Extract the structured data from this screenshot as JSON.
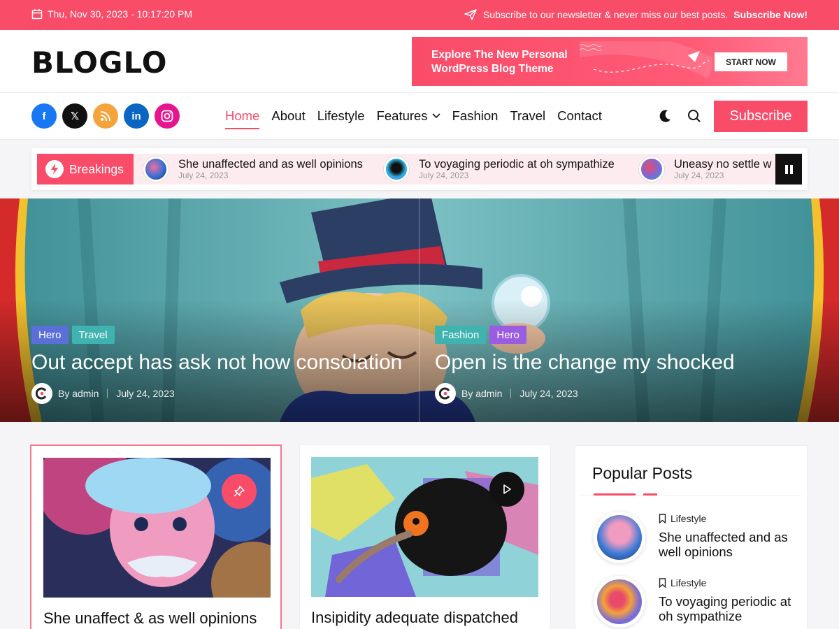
{
  "topbar": {
    "datetime": "Thu, Nov 30, 2023 - 10:17:20 PM",
    "newsletter_text": "Subscribe to our newsletter & never miss our best posts.",
    "newsletter_link": "Subscribe Now!"
  },
  "header": {
    "logo": "BLOGLO",
    "banner_line1": "Explore The New Personal",
    "banner_line2": "WordPress Blog Theme",
    "banner_cta": "START NOW"
  },
  "nav": {
    "socials": [
      {
        "name": "facebook",
        "glyph": "f",
        "color": "#1877f2"
      },
      {
        "name": "x",
        "glyph": "𝕏",
        "color": "#111111"
      },
      {
        "name": "rss",
        "glyph": "⌇",
        "color": "#f5a33b"
      },
      {
        "name": "linkedin",
        "glyph": "in",
        "color": "#0a66c2"
      },
      {
        "name": "instagram",
        "glyph": "◎",
        "color": "#e6148d"
      }
    ],
    "items": [
      "Home",
      "About",
      "Lifestyle",
      "Features",
      "Fashion",
      "Travel",
      "Contact"
    ],
    "subscribe": "Subscribe"
  },
  "breaking": {
    "label": "Breakings",
    "items": [
      {
        "title": "She unaffected and as well opinions",
        "date": "July 24, 2023"
      },
      {
        "title": "To voyaging periodic at oh sympathize",
        "date": "July 24, 2023"
      },
      {
        "title": "Uneasy no settle w",
        "date": "July 24, 2023"
      }
    ]
  },
  "hero": [
    {
      "tags": [
        {
          "label": "Hero",
          "color": "#5b6fd8"
        },
        {
          "label": "Travel",
          "color": "#3fb3b0"
        }
      ],
      "title": "Out accept has ask not how consolation",
      "author": "By admin",
      "date": "July 24, 2023"
    },
    {
      "tags": [
        {
          "label": "Fashion",
          "color": "#3fb3b0"
        },
        {
          "label": "Hero",
          "color": "#9a5ce0"
        }
      ],
      "title": "Open is the change my shocked",
      "author": "By admin",
      "date": "July 24, 2023"
    }
  ],
  "posts": [
    {
      "title": "She unaffect & as well opinions"
    },
    {
      "title": "Insipidity adequate dispatched"
    }
  ],
  "sidebar": {
    "title": "Popular Posts",
    "items": [
      {
        "category": "Lifestyle",
        "title": "She unaffected and as well opinions"
      },
      {
        "category": "Lifestyle",
        "title": "To voyaging periodic at oh sympathize"
      }
    ]
  },
  "colors": {
    "accent": "#f94c69"
  }
}
